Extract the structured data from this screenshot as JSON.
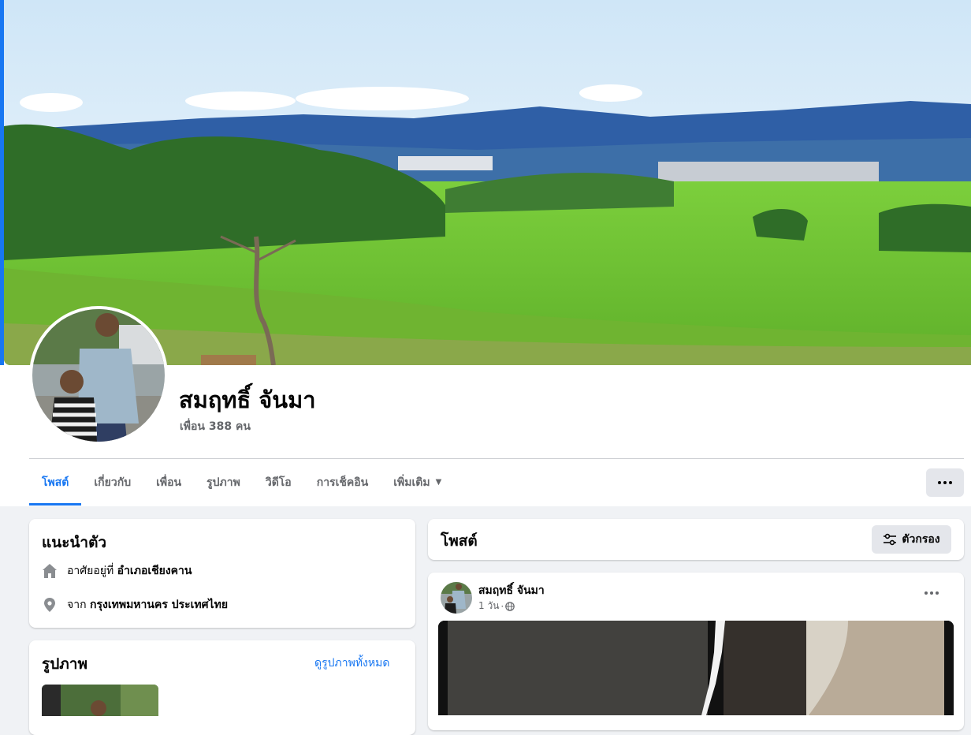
{
  "profile": {
    "name": "สมฤทธิ์ จันมา",
    "friends": "เพื่อน 388 คน"
  },
  "tabs": [
    {
      "label": "โพสต์",
      "active": true
    },
    {
      "label": "เกี่ยวกับ"
    },
    {
      "label": "เพื่อน"
    },
    {
      "label": "รูปภาพ"
    },
    {
      "label": "วิดีโอ"
    },
    {
      "label": "การเช็คอิน"
    },
    {
      "label": "เพิ่มเติม"
    }
  ],
  "intro": {
    "title": "แนะนำตัว",
    "lives_prefix": "อาศัยอยู่ที่",
    "lives_value": "อำเภอเชียงคาน",
    "from_prefix": "จาก",
    "from_value": "กรุงเทพมหานคร ประเทศไทย"
  },
  "photos": {
    "title": "รูปภาพ",
    "see_all": "ดูรูปภาพทั้งหมด"
  },
  "posts_header": {
    "title": "โพสต์",
    "filter_label": "ตัวกรอง"
  },
  "post": {
    "author": "สมฤทธิ์ จันมา",
    "time": "1 วัน",
    "separator": "·"
  },
  "colors": {
    "accent": "#1877f2",
    "background": "#f0f2f5",
    "secondary_text": "#65676b",
    "button_bg": "#e4e6eb"
  },
  "icons": [
    "home-icon",
    "location-pin-icon",
    "globe-icon",
    "filter-sliders-icon",
    "more-dots-icon",
    "caret-down-icon"
  ]
}
